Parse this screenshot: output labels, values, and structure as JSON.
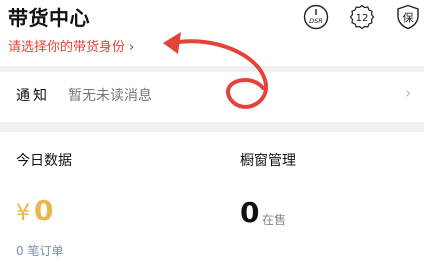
{
  "header": {
    "title": "带货中心",
    "role_link": "请选择你的带货身份",
    "icons": [
      {
        "name": "dsr-icon",
        "label": "DSR"
      },
      {
        "name": "level-icon",
        "label": "12"
      },
      {
        "name": "guarantee-icon",
        "label": "保"
      }
    ],
    "annotation_color": "#e5433a"
  },
  "notice": {
    "label": "通知",
    "message": "暂无未读消息"
  },
  "stats": {
    "today": {
      "title": "今日数据",
      "currency": "¥",
      "amount": "0",
      "orders": "0 笔订单"
    },
    "showcase": {
      "title": "橱窗管理",
      "count": "0",
      "unit": "在售"
    }
  }
}
